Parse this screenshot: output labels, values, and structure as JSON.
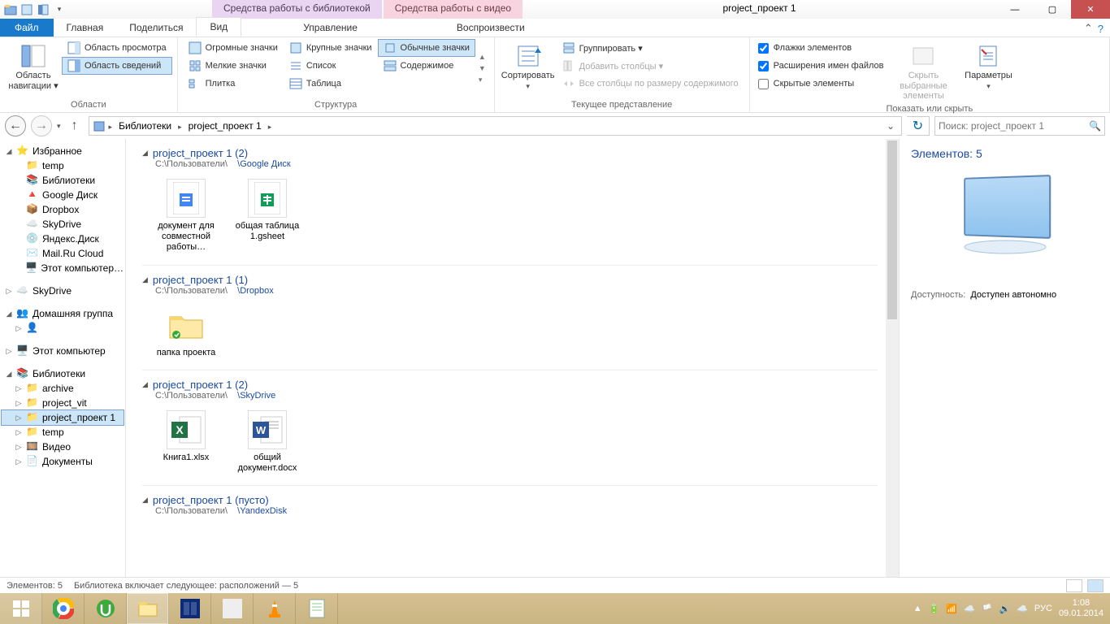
{
  "title": "project_проект 1",
  "context_tabs": {
    "library": "Средства работы с библиотекой",
    "video": "Средства работы с видео"
  },
  "tabs": {
    "file": "Файл",
    "home": "Главная",
    "share": "Поделиться",
    "view": "Вид",
    "manage": "Управление",
    "play": "Воспроизвести"
  },
  "ribbon": {
    "panes": {
      "nav_pane": "Область\nнавигации ▾",
      "preview": "Область просмотра",
      "details": "Область сведений",
      "group": "Области"
    },
    "layout": {
      "xl": "Огромные значки",
      "lg": "Крупные значки",
      "md": "Обычные значки",
      "sm": "Мелкие значки",
      "list": "Список",
      "detail": "Содержимое",
      "tiles": "Плитка",
      "table": "Таблица",
      "group": "Структура"
    },
    "sort": {
      "sort": "Сортировать",
      "groupby": "Группировать ▾",
      "addcols": "Добавить столбцы ▾",
      "autosize": "Все столбцы по размеру содержимого",
      "group": "Текущее представление"
    },
    "show": {
      "checkboxes": "Флажки элементов",
      "ext": "Расширения имен файлов",
      "hidden": "Скрытые элементы",
      "hide": "Скрыть выбранные\nэлементы",
      "options": "Параметры",
      "group": "Показать или скрыть"
    }
  },
  "breadcrumbs": {
    "root": "Библиотеки",
    "current": "project_проект 1"
  },
  "search_placeholder": "Поиск: project_проект 1",
  "tree": {
    "favorites": "Избранное",
    "fav_items": [
      "temp",
      "Библиотеки",
      "Google Диск",
      "Dropbox",
      "SkyDrive",
      "Яндекс.Диск",
      "Mail.Ru Cloud",
      "Этот компьютер…"
    ],
    "skydrive": "SkyDrive",
    "homegroup": "Домашняя группа",
    "thispc": "Этот компьютер",
    "libraries": "Библиотеки",
    "lib_items": [
      "archive",
      "project_vit",
      "project_проект 1",
      "temp",
      "Видео",
      "Документы"
    ]
  },
  "groups": [
    {
      "title": "project_проект 1 (2)",
      "path_a": "C:\\Пользователи\\",
      "path_b": "\\Google Диск",
      "items": [
        {
          "name": "документ для совместной работы…",
          "icon": "gdoc"
        },
        {
          "name": "общая таблица 1.gsheet",
          "icon": "gsheet"
        }
      ]
    },
    {
      "title": "project_проект 1 (1)",
      "path_a": "C:\\Пользователи\\",
      "path_b": "\\Dropbox",
      "items": [
        {
          "name": "папка проекта",
          "icon": "folder"
        }
      ]
    },
    {
      "title": "project_проект 1 (2)",
      "path_a": "C:\\Пользователи\\",
      "path_b": "\\SkyDrive",
      "items": [
        {
          "name": "Книга1.xlsx",
          "icon": "xlsx"
        },
        {
          "name": "общий документ.docx",
          "icon": "docx"
        }
      ]
    },
    {
      "title": "project_проект 1 (пусто)",
      "path_a": "C:\\Пользователи\\",
      "path_b": "\\YandexDisk",
      "items": []
    }
  ],
  "details": {
    "heading": "Элементов: 5",
    "avail_k": "Доступность:",
    "avail_v": "Доступен автономно"
  },
  "status": {
    "count": "Элементов: 5",
    "lib": "Библиотека включает следующее: расположений — 5"
  },
  "taskbar": {
    "lang": "РУС",
    "time": "1:08",
    "date": "09.01.2014"
  }
}
